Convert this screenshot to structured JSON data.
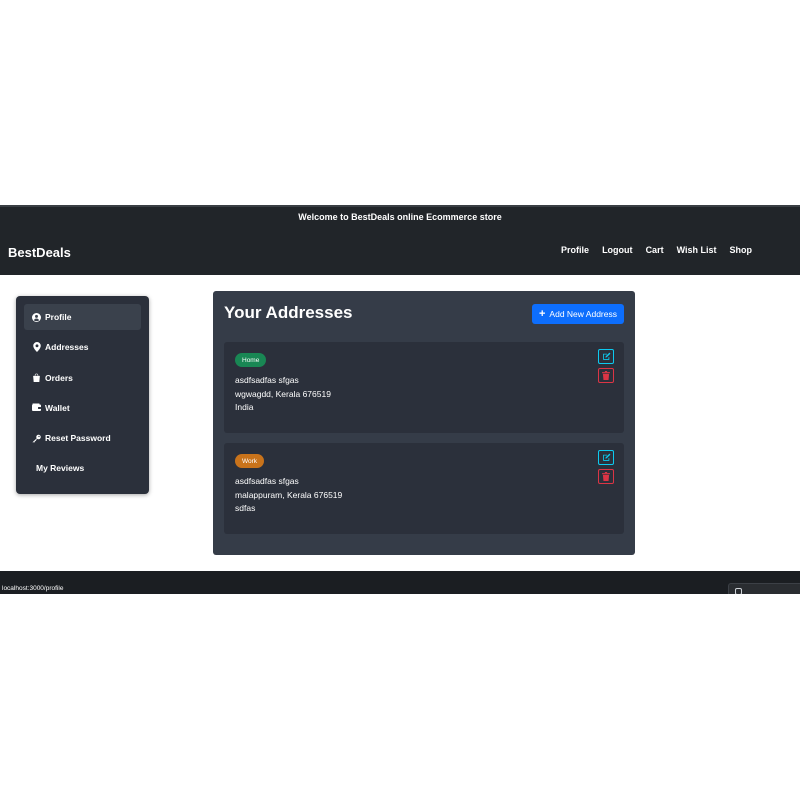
{
  "header": {
    "welcome": "Welcome to BestDeals online Ecommerce store",
    "brand": "BestDeals",
    "nav": [
      "Profile",
      "Logout",
      "Cart",
      "Wish List",
      "Shop"
    ]
  },
  "sidebar": {
    "items": [
      {
        "label": "Profile",
        "icon": "user-circle-icon",
        "active": true
      },
      {
        "label": "Addresses",
        "icon": "location-pin-icon"
      },
      {
        "label": "Orders",
        "icon": "shopping-bag-icon"
      },
      {
        "label": "Wallet",
        "icon": "wallet-icon"
      },
      {
        "label": "Reset Password",
        "icon": "key-icon"
      },
      {
        "label": "My Reviews",
        "icon": ""
      }
    ]
  },
  "main": {
    "title": "Your Addresses",
    "add_button": "Add New Address",
    "addresses": [
      {
        "type": "Home",
        "line1": "asdfsadfas sfgas",
        "line2": "wgwagdd, Kerala 676519",
        "line3": "India"
      },
      {
        "type": "Work",
        "line1": "asdfsadfas sfgas",
        "line2": "malappuram, Kerala 676519",
        "line3": "sdfas"
      }
    ]
  },
  "status_bar": {
    "url": "localhost:3000/profile"
  },
  "colors": {
    "navbar": "#212529",
    "panel": "#353c48",
    "card": "#2b303b",
    "primary": "#0d6efd",
    "home_badge": "#198754",
    "work_badge": "#c9731b",
    "edit": "#0dcaf0",
    "delete": "#dc3545"
  }
}
